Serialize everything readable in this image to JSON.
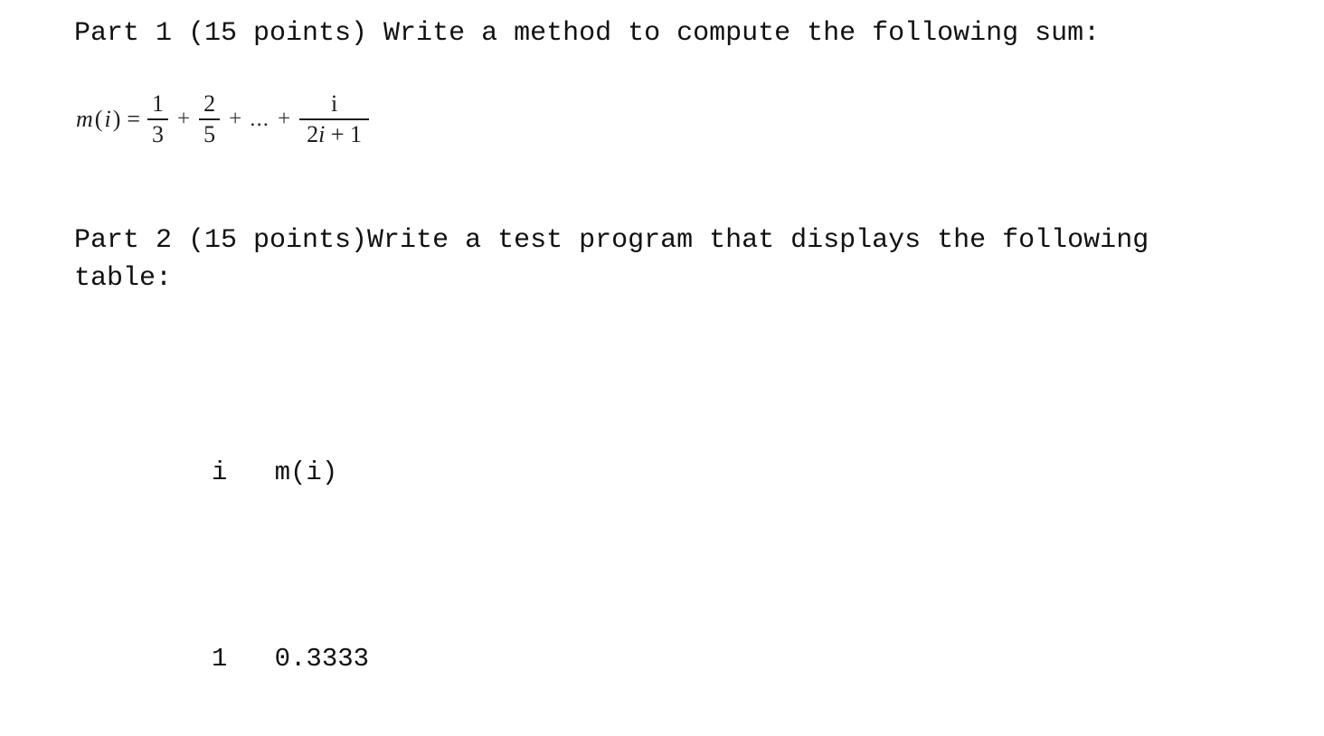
{
  "document": {
    "background_color": "#ffffff",
    "text_color": "#111111",
    "part1_line": "Part 1 (15 points) Write a method to compute the following sum:",
    "part2_line1": "Part 2 (15 points)Write a test program that displays the following",
    "part2_line2": "table:",
    "formula": {
      "lhs_function": "m",
      "lhs_open_paren": "(",
      "lhs_variable": "i",
      "lhs_close_paren": ")",
      "equals": "=",
      "term1": {
        "numerator": "1",
        "denominator": "3"
      },
      "plus1": "+",
      "term2": {
        "numerator": "2",
        "denominator": "5"
      },
      "plus2": "+",
      "ellipsis": "...",
      "plus3": "+",
      "term_last": {
        "numerator": "i",
        "denominator_coeff": "2",
        "denominator_variable": "i",
        "denominator_op": "+",
        "denominator_const": "1"
      },
      "plain_text": "m(i) = 1/3 + 2/5 + ... + i/(2i + 1)"
    },
    "output_table": {
      "header": "i   m(i)",
      "header_cells": [
        "i",
        "m(i)"
      ],
      "rows": [
        {
          "line": "1   0.3333",
          "i": "1",
          "m_i": "0.3333"
        }
      ]
    }
  }
}
